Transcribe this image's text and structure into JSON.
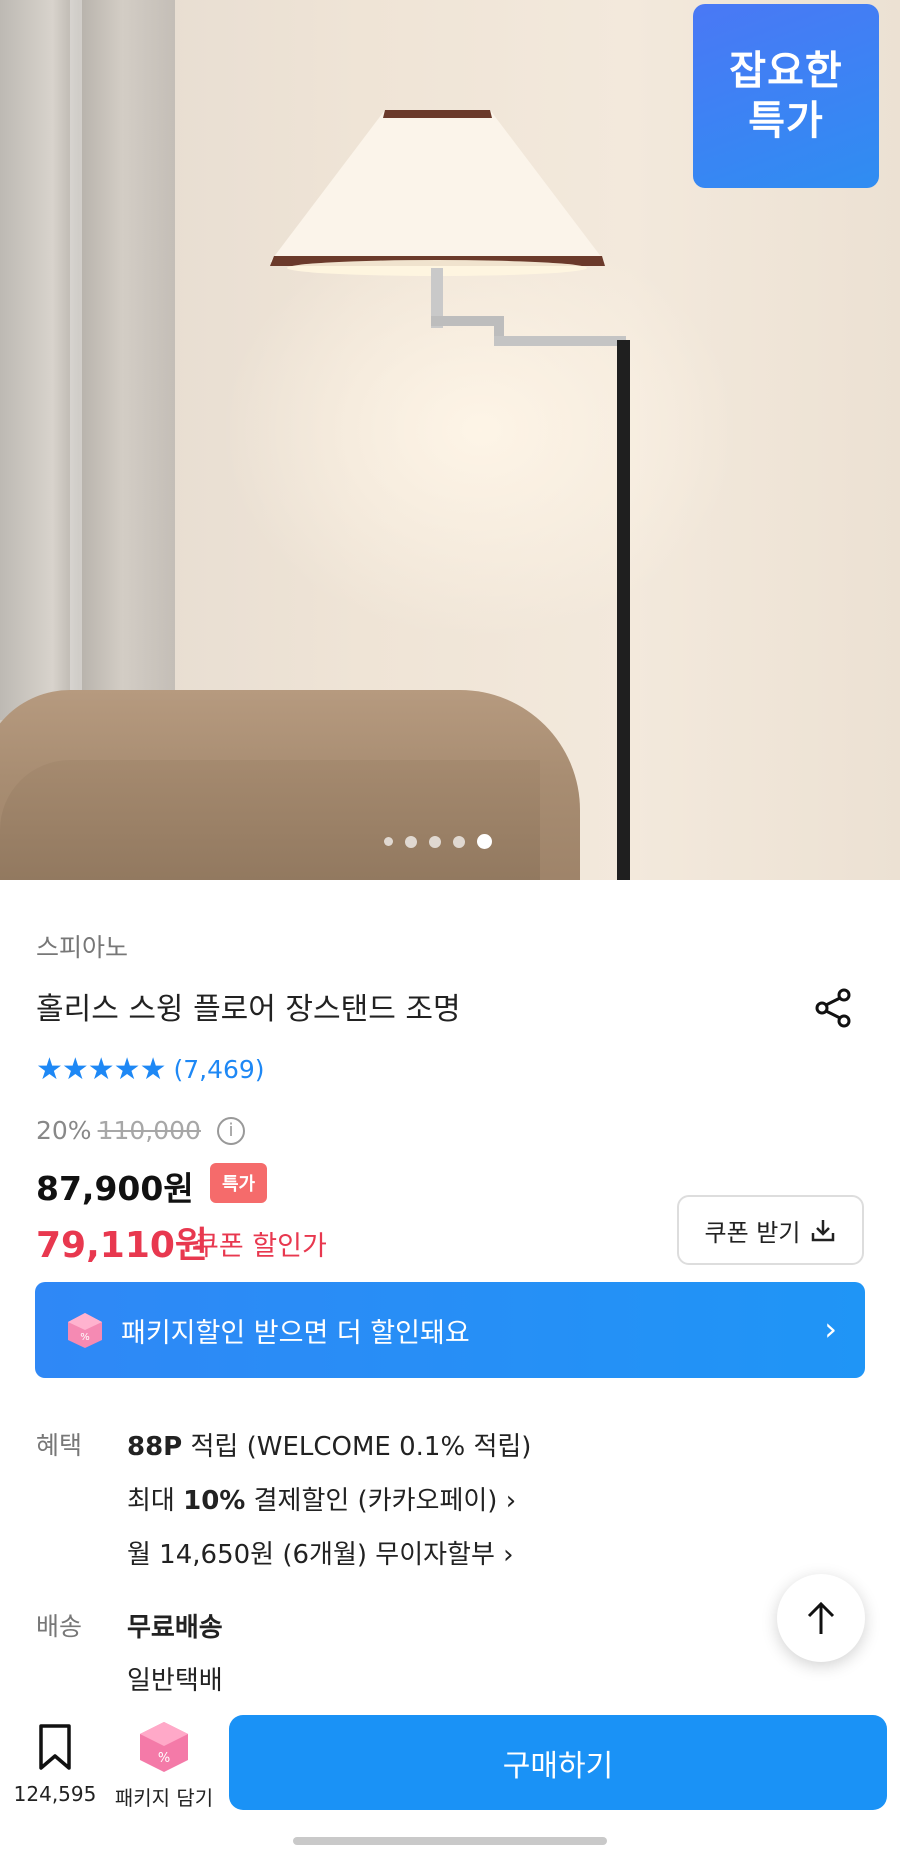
{
  "hero": {
    "badge_line1": "잡요한",
    "badge_line2": "특가",
    "carousel": {
      "count": 5,
      "active_index": 4
    }
  },
  "product": {
    "brand": "스피아노",
    "title": "홀리스 스윙 플로어 장스탠드 조명",
    "stars": "★★★★★",
    "review_count": "(7,469)",
    "discount_rate": "20%",
    "original_price": "110,000",
    "price": "87,900원",
    "price_tag": "특가",
    "coupon_price": "79,110원",
    "coupon_label": "쿠폰 할인가",
    "coupon_button": "쿠폰 받기"
  },
  "package_banner": {
    "text": "패키지할인 받으면 더 할인돼요",
    "chevron": "›"
  },
  "benefits": {
    "label": "혜택",
    "line1_points": "88P",
    "line1_rest": "적립 (WELCOME 0.1% 적립)",
    "line2_prefix": "최대",
    "line2_bold": "10%",
    "line2_rest": "결제할인 (카카오페이) ›",
    "line3": "월 14,650원 (6개월) 무이자할부 ›"
  },
  "shipping": {
    "label": "배송",
    "type": "무료배송",
    "method": "일반택배"
  },
  "bottom_bar": {
    "bookmark_count": "124,595",
    "package_add_label": "패키지 담기",
    "buy_button": "구매하기"
  },
  "colors": {
    "accent": "#1a92f6",
    "sale_red": "#e8384f",
    "tag_red": "#f56b6b",
    "star_blue": "#1e88f5"
  }
}
